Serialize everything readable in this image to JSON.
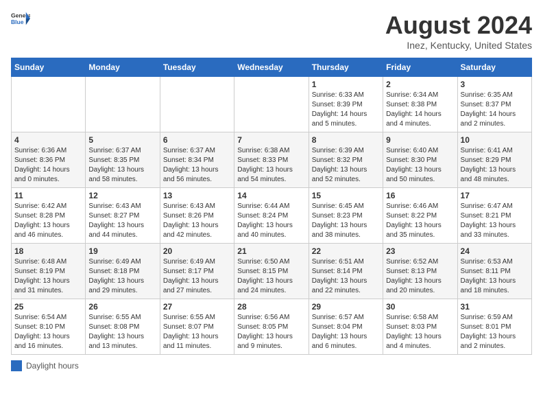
{
  "header": {
    "logo_general": "General",
    "logo_blue": "Blue",
    "title": "August 2024",
    "subtitle": "Inez, Kentucky, United States"
  },
  "calendar": {
    "days_of_week": [
      "Sunday",
      "Monday",
      "Tuesday",
      "Wednesday",
      "Thursday",
      "Friday",
      "Saturday"
    ],
    "weeks": [
      [
        {
          "day": "",
          "info": ""
        },
        {
          "day": "",
          "info": ""
        },
        {
          "day": "",
          "info": ""
        },
        {
          "day": "",
          "info": ""
        },
        {
          "day": "1",
          "info": "Sunrise: 6:33 AM\nSunset: 8:39 PM\nDaylight: 14 hours\nand 5 minutes."
        },
        {
          "day": "2",
          "info": "Sunrise: 6:34 AM\nSunset: 8:38 PM\nDaylight: 14 hours\nand 4 minutes."
        },
        {
          "day": "3",
          "info": "Sunrise: 6:35 AM\nSunset: 8:37 PM\nDaylight: 14 hours\nand 2 minutes."
        }
      ],
      [
        {
          "day": "4",
          "info": "Sunrise: 6:36 AM\nSunset: 8:36 PM\nDaylight: 14 hours\nand 0 minutes."
        },
        {
          "day": "5",
          "info": "Sunrise: 6:37 AM\nSunset: 8:35 PM\nDaylight: 13 hours\nand 58 minutes."
        },
        {
          "day": "6",
          "info": "Sunrise: 6:37 AM\nSunset: 8:34 PM\nDaylight: 13 hours\nand 56 minutes."
        },
        {
          "day": "7",
          "info": "Sunrise: 6:38 AM\nSunset: 8:33 PM\nDaylight: 13 hours\nand 54 minutes."
        },
        {
          "day": "8",
          "info": "Sunrise: 6:39 AM\nSunset: 8:32 PM\nDaylight: 13 hours\nand 52 minutes."
        },
        {
          "day": "9",
          "info": "Sunrise: 6:40 AM\nSunset: 8:30 PM\nDaylight: 13 hours\nand 50 minutes."
        },
        {
          "day": "10",
          "info": "Sunrise: 6:41 AM\nSunset: 8:29 PM\nDaylight: 13 hours\nand 48 minutes."
        }
      ],
      [
        {
          "day": "11",
          "info": "Sunrise: 6:42 AM\nSunset: 8:28 PM\nDaylight: 13 hours\nand 46 minutes."
        },
        {
          "day": "12",
          "info": "Sunrise: 6:43 AM\nSunset: 8:27 PM\nDaylight: 13 hours\nand 44 minutes."
        },
        {
          "day": "13",
          "info": "Sunrise: 6:43 AM\nSunset: 8:26 PM\nDaylight: 13 hours\nand 42 minutes."
        },
        {
          "day": "14",
          "info": "Sunrise: 6:44 AM\nSunset: 8:24 PM\nDaylight: 13 hours\nand 40 minutes."
        },
        {
          "day": "15",
          "info": "Sunrise: 6:45 AM\nSunset: 8:23 PM\nDaylight: 13 hours\nand 38 minutes."
        },
        {
          "day": "16",
          "info": "Sunrise: 6:46 AM\nSunset: 8:22 PM\nDaylight: 13 hours\nand 35 minutes."
        },
        {
          "day": "17",
          "info": "Sunrise: 6:47 AM\nSunset: 8:21 PM\nDaylight: 13 hours\nand 33 minutes."
        }
      ],
      [
        {
          "day": "18",
          "info": "Sunrise: 6:48 AM\nSunset: 8:19 PM\nDaylight: 13 hours\nand 31 minutes."
        },
        {
          "day": "19",
          "info": "Sunrise: 6:49 AM\nSunset: 8:18 PM\nDaylight: 13 hours\nand 29 minutes."
        },
        {
          "day": "20",
          "info": "Sunrise: 6:49 AM\nSunset: 8:17 PM\nDaylight: 13 hours\nand 27 minutes."
        },
        {
          "day": "21",
          "info": "Sunrise: 6:50 AM\nSunset: 8:15 PM\nDaylight: 13 hours\nand 24 minutes."
        },
        {
          "day": "22",
          "info": "Sunrise: 6:51 AM\nSunset: 8:14 PM\nDaylight: 13 hours\nand 22 minutes."
        },
        {
          "day": "23",
          "info": "Sunrise: 6:52 AM\nSunset: 8:13 PM\nDaylight: 13 hours\nand 20 minutes."
        },
        {
          "day": "24",
          "info": "Sunrise: 6:53 AM\nSunset: 8:11 PM\nDaylight: 13 hours\nand 18 minutes."
        }
      ],
      [
        {
          "day": "25",
          "info": "Sunrise: 6:54 AM\nSunset: 8:10 PM\nDaylight: 13 hours\nand 16 minutes."
        },
        {
          "day": "26",
          "info": "Sunrise: 6:55 AM\nSunset: 8:08 PM\nDaylight: 13 hours\nand 13 minutes."
        },
        {
          "day": "27",
          "info": "Sunrise: 6:55 AM\nSunset: 8:07 PM\nDaylight: 13 hours\nand 11 minutes."
        },
        {
          "day": "28",
          "info": "Sunrise: 6:56 AM\nSunset: 8:05 PM\nDaylight: 13 hours\nand 9 minutes."
        },
        {
          "day": "29",
          "info": "Sunrise: 6:57 AM\nSunset: 8:04 PM\nDaylight: 13 hours\nand 6 minutes."
        },
        {
          "day": "30",
          "info": "Sunrise: 6:58 AM\nSunset: 8:03 PM\nDaylight: 13 hours\nand 4 minutes."
        },
        {
          "day": "31",
          "info": "Sunrise: 6:59 AM\nSunset: 8:01 PM\nDaylight: 13 hours\nand 2 minutes."
        }
      ]
    ]
  },
  "legend": {
    "label": "Daylight hours"
  }
}
